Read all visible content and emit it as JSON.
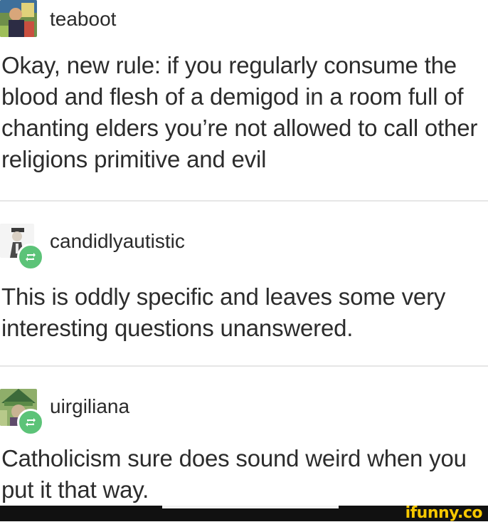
{
  "posts": [
    {
      "username": "teaboot",
      "text": "Okay, new rule: if you regularly consume the blood and flesh of a demigod in a room full of chanting elders you’re not allowed to call other religions primitive and evil"
    },
    {
      "username": "candidlyautistic",
      "text": "This is oddly specific and leaves some very interesting questions unanswered."
    },
    {
      "username": "uirgiliana",
      "text": "Catholicism sure does sound weird when you put it that way."
    }
  ],
  "watermark": "ifunny.co",
  "colors": {
    "reblog_badge": "#5cc378",
    "watermark": "#f7c800",
    "text": "#2c2c2c"
  }
}
